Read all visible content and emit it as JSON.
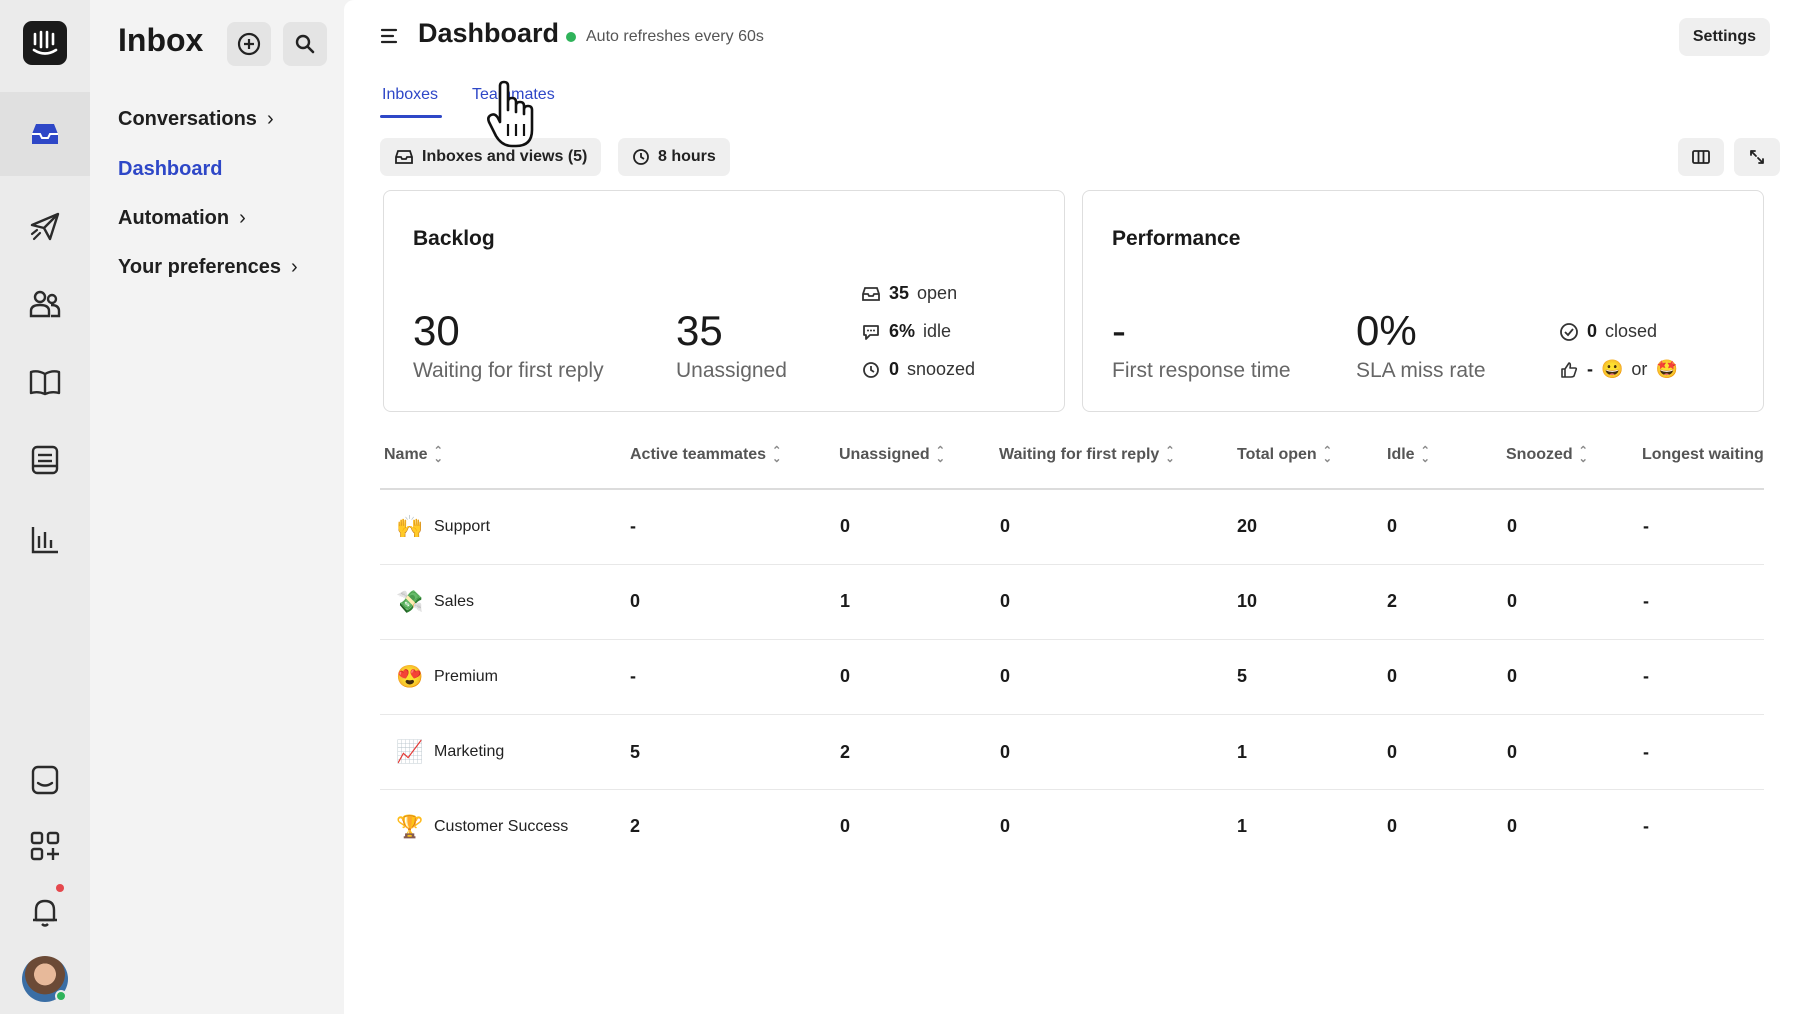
{
  "sidebar": {
    "title": "Inbox",
    "nav": [
      {
        "label": "Conversations",
        "chevron": "›"
      },
      {
        "label": "Dashboard"
      },
      {
        "label": "Automation",
        "chevron": "›"
      },
      {
        "label": "Your preferences",
        "chevron": "›"
      }
    ]
  },
  "header": {
    "title": "Dashboard",
    "refresh_text": "Auto refreshes every 60s",
    "settings_label": "Settings"
  },
  "tabs": [
    {
      "label": "Inboxes"
    },
    {
      "label": "Teammates"
    }
  ],
  "filters": {
    "inboxes_label": "Inboxes and views (5)",
    "time_label": "8 hours"
  },
  "backlog": {
    "title": "Backlog",
    "waiting_value": "30",
    "waiting_label": "Waiting for first reply",
    "unassigned_value": "35",
    "unassigned_label": "Unassigned",
    "open_value": "35",
    "open_label": "open",
    "idle_value": "6%",
    "idle_label": "idle",
    "snoozed_value": "0",
    "snoozed_label": "snoozed"
  },
  "performance": {
    "title": "Performance",
    "frt_value": "-",
    "frt_label": "First response time",
    "sla_value": "0%",
    "sla_label": "SLA miss rate",
    "closed_value": "0",
    "closed_label": "closed",
    "csat_dash": "-",
    "csat_or": "or"
  },
  "table": {
    "columns": [
      "Name",
      "Active teammates",
      "Unassigned",
      "Waiting for first reply",
      "Total open",
      "Idle",
      "Snoozed",
      "Longest waiting"
    ],
    "rows": [
      {
        "emoji": "🙌",
        "name": "Support",
        "active": "-",
        "unassigned": "0",
        "waiting": "0",
        "total_open": "20",
        "idle": "0",
        "snoozed": "0",
        "longest": "-"
      },
      {
        "emoji": "💸",
        "name": "Sales",
        "active": "0",
        "unassigned": "1",
        "waiting": "0",
        "total_open": "10",
        "idle": "2",
        "snoozed": "0",
        "longest": "-"
      },
      {
        "emoji": "😍",
        "name": "Premium",
        "active": "-",
        "unassigned": "0",
        "waiting": "0",
        "total_open": "5",
        "idle": "0",
        "snoozed": "0",
        "longest": "-"
      },
      {
        "emoji": "📈",
        "name": "Marketing",
        "active": "5",
        "unassigned": "2",
        "waiting": "0",
        "total_open": "1",
        "idle": "0",
        "snoozed": "0",
        "longest": "-"
      },
      {
        "emoji": "🏆",
        "name": "Customer Success",
        "active": "2",
        "unassigned": "0",
        "waiting": "0",
        "total_open": "1",
        "idle": "0",
        "snoozed": "0",
        "longest": "-"
      }
    ]
  },
  "colors": {
    "accent": "#2e47c7",
    "live": "#2fb35a",
    "notification": "#e5484d"
  }
}
